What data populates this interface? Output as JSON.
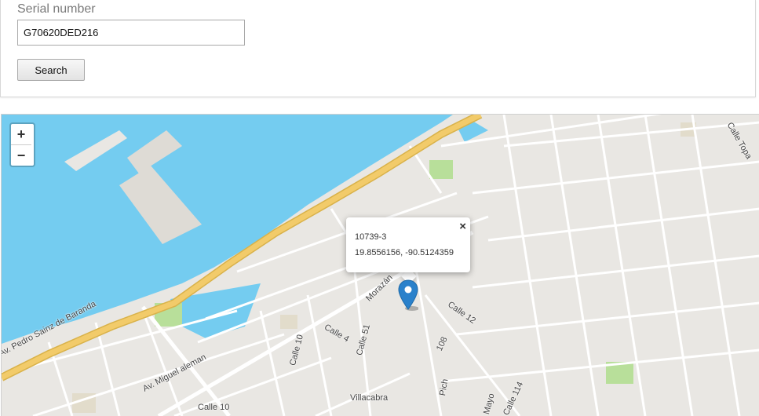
{
  "search": {
    "label": "Serial number",
    "value": "G70620DED216",
    "button_label": "Search"
  },
  "map": {
    "zoom_in_label": "+",
    "zoom_out_label": "−",
    "popup": {
      "close_label": "×",
      "title": "10739-3",
      "coordinates": "19.8556156, -90.5124359"
    },
    "streets": {
      "pedro": "Av. Pedro Sainz de Baranda",
      "miguel": "Av. Miguel aleman",
      "calle10a": "Calle 10",
      "calle10b": "Calle 10",
      "calle4": "Calle 4",
      "calle51": "Calle 51",
      "morazan": "Morazán",
      "calle12": "Calle 12",
      "c108": "108",
      "pich": "Pich",
      "villacabra": "Villacabra",
      "mayo": "Mayo",
      "calle114": "Calle 114",
      "calletopa": "Calle Topa"
    },
    "colors": {
      "water": "#74ccf0",
      "land": "#e9e7e3",
      "highway": "#f2cb6a",
      "park": "#b8df9a",
      "marker": "#2a81cb"
    }
  }
}
